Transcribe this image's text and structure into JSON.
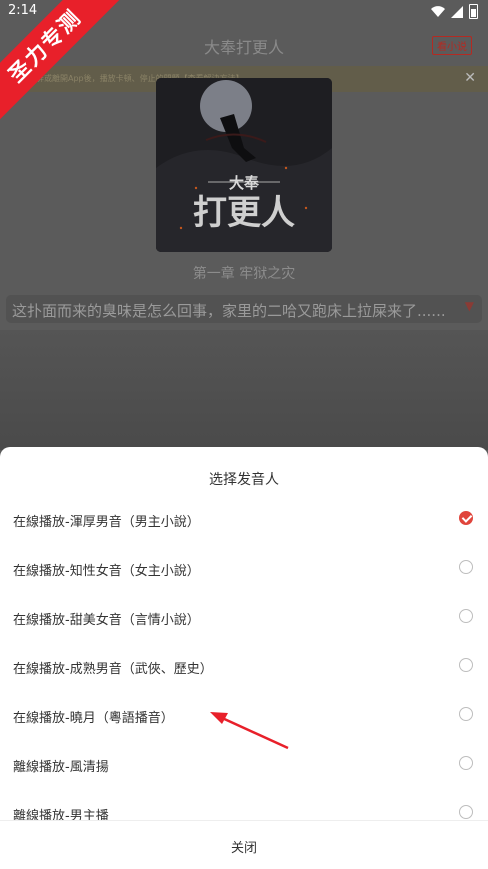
{
  "status": {
    "time": "2:14"
  },
  "ribbon": {
    "text": "圣力专测"
  },
  "header": {
    "title": "大奉打更人",
    "tag": "看小说"
  },
  "notice": {
    "text": "說屏或離開App後，播放卡頓、停止的問題【查看解決方法】"
  },
  "cover": {
    "title_small": "大奉",
    "title_large": "打更人"
  },
  "chapter": {
    "title": "第一章 牢狱之灾"
  },
  "content": {
    "text": "这扑面而来的臭味是怎么回事，家里的二哈又跑床上拉屎来了......"
  },
  "sheet": {
    "title": "选择发音人",
    "voices": [
      {
        "label": "在線播放-渾厚男音（男主小說）",
        "selected": true
      },
      {
        "label": "在線播放-知性女音（女主小說）",
        "selected": false
      },
      {
        "label": "在線播放-甜美女音（言情小說）",
        "selected": false
      },
      {
        "label": "在線播放-成熟男音（武俠、歷史）",
        "selected": false
      },
      {
        "label": "在線播放-曉月（粵語播音）",
        "selected": false
      },
      {
        "label": "離線播放-風清揚",
        "selected": false
      },
      {
        "label": "離線播放-男主播",
        "selected": false
      }
    ],
    "close_label": "关闭"
  },
  "colors": {
    "accent": "#e0453c",
    "ribbon": "#e8202a"
  }
}
